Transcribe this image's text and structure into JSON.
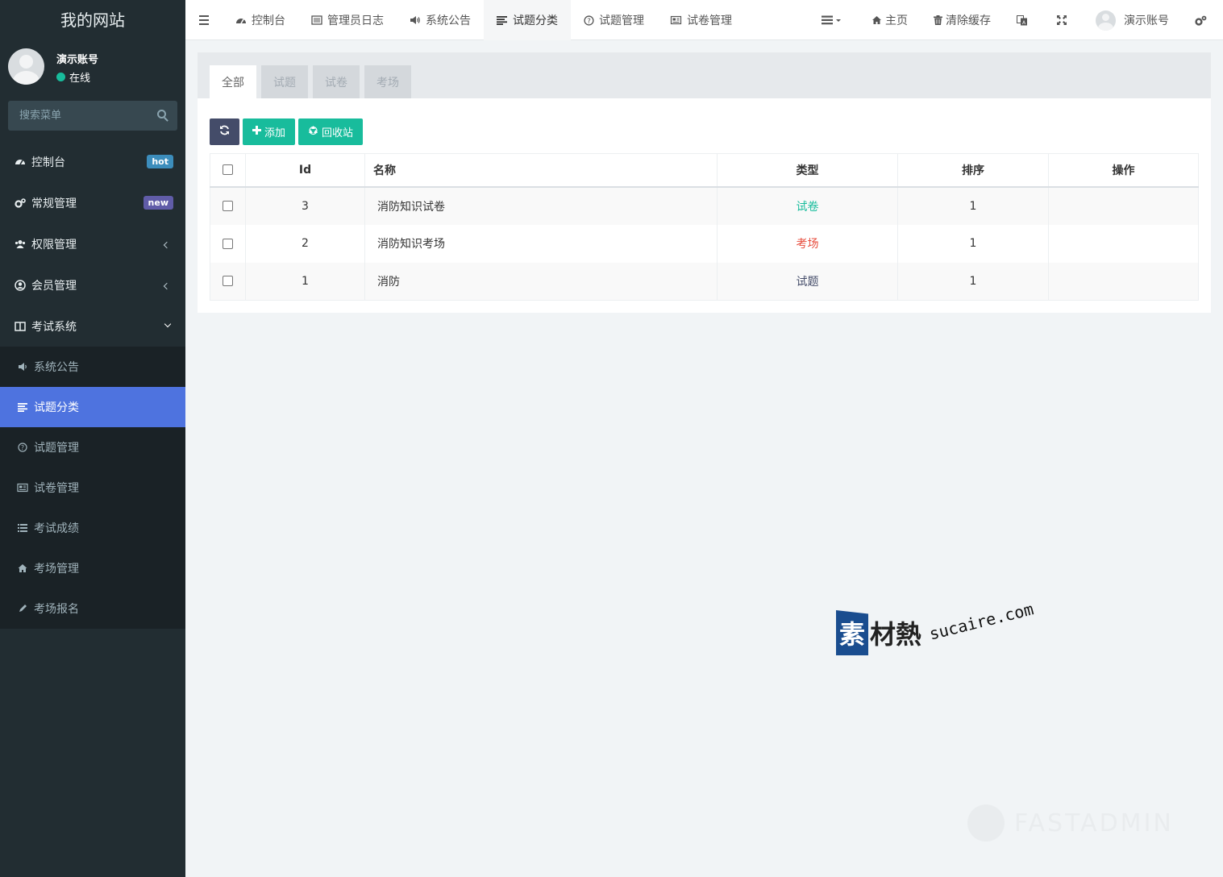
{
  "sidebar": {
    "site_title": "我的网站",
    "user": {
      "name": "演示账号",
      "status": "在线"
    },
    "search_placeholder": "搜索菜单",
    "menu": [
      {
        "label": "控制台",
        "icon": "dashboard-icon",
        "badge": "hot",
        "badge_color": "#3c8dbc"
      },
      {
        "label": "常规管理",
        "icon": "cogs-icon",
        "badge": "new",
        "badge_color": "#605ca8"
      },
      {
        "label": "权限管理",
        "icon": "group-icon"
      },
      {
        "label": "会员管理",
        "icon": "user-circle-icon"
      },
      {
        "label": "考试系统",
        "icon": "columns-icon"
      }
    ],
    "submenu": [
      {
        "label": "系统公告",
        "icon": "bullhorn-icon"
      },
      {
        "label": "试题分类",
        "icon": "align-left-icon",
        "active": true
      },
      {
        "label": "试题管理",
        "icon": "question-circle-icon"
      },
      {
        "label": "试卷管理",
        "icon": "newspaper-icon"
      },
      {
        "label": "考试成绩",
        "icon": "list-icon"
      },
      {
        "label": "考场管理",
        "icon": "home-icon"
      },
      {
        "label": "考场报名",
        "icon": "pencil-icon"
      }
    ]
  },
  "navbar": {
    "tabs": [
      {
        "label": "控制台",
        "icon": "dashboard-icon"
      },
      {
        "label": "管理员日志",
        "icon": "list-alt-icon"
      },
      {
        "label": "系统公告",
        "icon": "bullhorn-icon"
      },
      {
        "label": "试题分类",
        "icon": "align-left-icon",
        "active": true
      },
      {
        "label": "试题管理",
        "icon": "question-circle-icon"
      },
      {
        "label": "试卷管理",
        "icon": "newspaper-icon"
      }
    ],
    "right": {
      "home": "主页",
      "clear_cache": "清除缓存",
      "user": "演示账号"
    }
  },
  "content": {
    "filter_tabs": [
      "全部",
      "试题",
      "试卷",
      "考场"
    ],
    "toolbar": {
      "add": "添加",
      "recycle": "回收站"
    },
    "columns": [
      "Id",
      "名称",
      "类型",
      "排序",
      "操作"
    ],
    "rows": [
      {
        "id": "3",
        "name": "消防知识试卷",
        "type": "试卷",
        "type_color": "#18bc9c",
        "sort": "1"
      },
      {
        "id": "2",
        "name": "消防知识考场",
        "type": "考场",
        "type_color": "#e74c3c",
        "sort": "1"
      },
      {
        "id": "1",
        "name": "消防",
        "type": "试题",
        "type_color": "#444c69",
        "sort": "1"
      }
    ]
  },
  "watermark": {
    "logo_first": "素",
    "logo_rest": "材熱",
    "url": "sucaire.com",
    "brand": "FASTADMIN"
  }
}
